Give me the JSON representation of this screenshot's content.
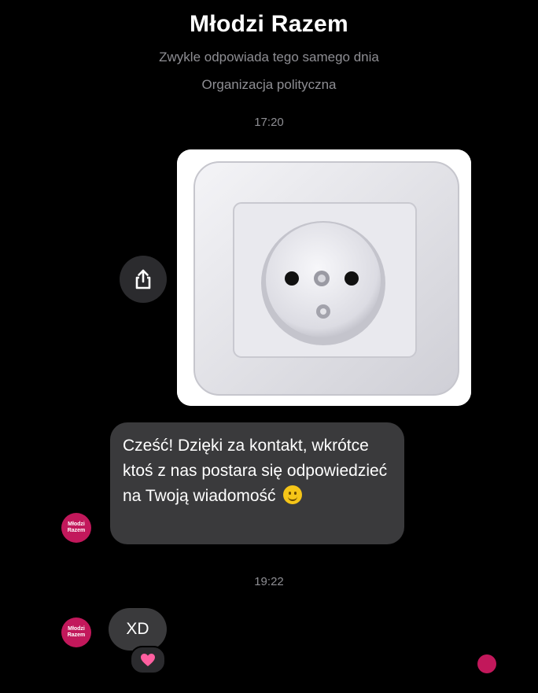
{
  "header": {
    "title": "Młodzi Razem",
    "subtitle": "Zwykle odpowiada tego samego dnia",
    "category": "Organizacja polityczna"
  },
  "conversation": {
    "timestamp_1": "17:20",
    "timestamp_2": "19:22",
    "auto_reply": "Cześć! Dzięki za kontakt, wkrótce ktoś z nas postara się odpowiedzieć na Twoją wiadomość",
    "reply": "XD",
    "avatar_text_line1": "Młodzi",
    "avatar_text_line2": "Razem"
  },
  "icons": {
    "share": "share-icon",
    "reaction": "heart-icon",
    "emoji": "smile-emoji-icon"
  },
  "colors": {
    "background": "#000000",
    "bubble": "#3a3a3c",
    "secondary_text": "#8e8e93",
    "avatar": "#c2185b",
    "heart": "#ff5fa0"
  }
}
